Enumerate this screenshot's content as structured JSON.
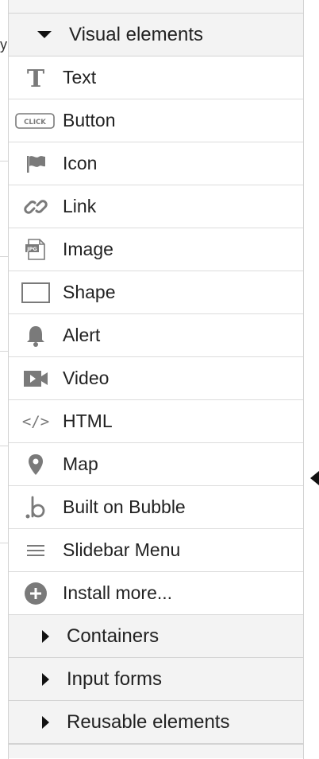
{
  "visual_section": {
    "title": "Visual elements",
    "expanded": true,
    "items": [
      {
        "label": "Text",
        "icon": "text-T-icon"
      },
      {
        "label": "Button",
        "icon": "button-click-icon",
        "icon_text": "CLICK"
      },
      {
        "label": "Icon",
        "icon": "flag-icon"
      },
      {
        "label": "Link",
        "icon": "link-icon"
      },
      {
        "label": "Image",
        "icon": "image-jpg-icon",
        "icon_text": "JPG"
      },
      {
        "label": "Shape",
        "icon": "rectangle-shape-icon"
      },
      {
        "label": "Alert",
        "icon": "bell-icon"
      },
      {
        "label": "Video",
        "icon": "video-camera-icon"
      },
      {
        "label": "HTML",
        "icon": "code-icon",
        "icon_text": "</>"
      },
      {
        "label": "Map",
        "icon": "map-pin-icon"
      },
      {
        "label": "Built on Bubble",
        "icon": "bubble-logo-icon"
      },
      {
        "label": "Slidebar Menu",
        "icon": "hamburger-icon"
      },
      {
        "label": "Install more...",
        "icon": "plus-circle-icon"
      }
    ]
  },
  "collapsed_sections": [
    {
      "title": "Containers"
    },
    {
      "title": "Input forms"
    },
    {
      "title": "Reusable elements"
    }
  ],
  "colors": {
    "icon": "#7a7a7a",
    "header_bg": "#f3f3f3",
    "divider": "#d3d3d3"
  }
}
